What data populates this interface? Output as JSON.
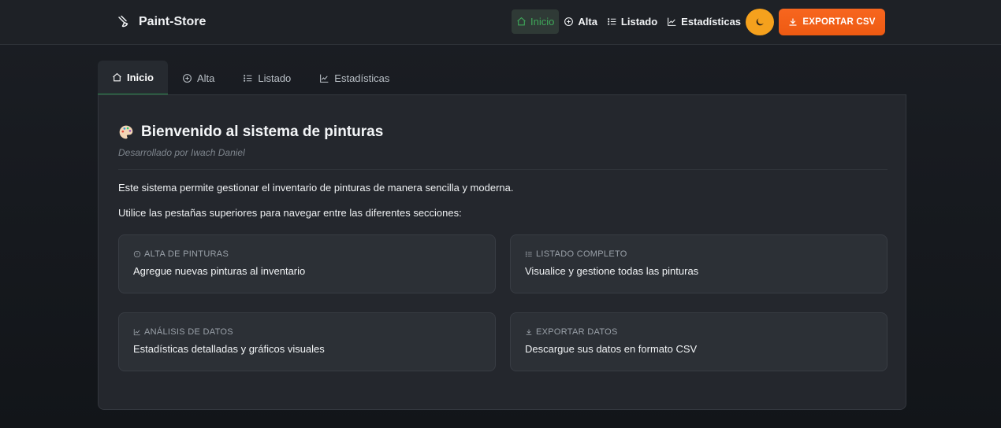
{
  "brand": {
    "name": "Paint-Store",
    "icon": "paint-brush-icon"
  },
  "nav": {
    "items": [
      {
        "label": "Inicio",
        "icon": "home-icon",
        "active": true
      },
      {
        "label": "Alta",
        "icon": "plus-circle-icon",
        "active": false
      },
      {
        "label": "Listado",
        "icon": "list-icon",
        "active": false
      },
      {
        "label": "Estadísticas",
        "icon": "chart-line-icon",
        "active": false
      }
    ],
    "theme_toggle_icon": "moon-icon",
    "export_label": "EXPORTAR CSV"
  },
  "tabs": [
    {
      "label": "Inicio",
      "icon": "home-icon",
      "active": true
    },
    {
      "label": "Alta",
      "icon": "plus-circle-icon",
      "active": false
    },
    {
      "label": "Listado",
      "icon": "list-icon",
      "active": false
    },
    {
      "label": "Estadísticas",
      "icon": "chart-line-icon",
      "active": false
    }
  ],
  "main": {
    "title": "Bienvenido al sistema de pinturas",
    "subtitle": "Desarrollado por Iwach Daniel",
    "paragraph1": "Este sistema permite gestionar el inventario de pinturas de manera sencilla y moderna.",
    "paragraph2": "Utilice las pestañas superiores para navegar entre las diferentes secciones:",
    "cards": [
      {
        "label": "ALTA DE PINTURAS",
        "icon": "info-circle-icon",
        "description": "Agregue nuevas pinturas al inventario"
      },
      {
        "label": "LISTADO COMPLETO",
        "icon": "list-icon",
        "description": "Visualice y gestione todas las pinturas"
      },
      {
        "label": "ANÁLISIS DE DATOS",
        "icon": "chart-line-icon",
        "description": "Estadísticas detalladas y gráficos visuales"
      },
      {
        "label": "EXPORTAR DATOS",
        "icon": "download-icon",
        "description": "Descargue sus datos en formato CSV"
      }
    ]
  },
  "colors": {
    "accent_green": "#3fa95a",
    "theme_button": "#f5a11d",
    "export_button": "#f7661f",
    "background": "#1b1e24"
  }
}
